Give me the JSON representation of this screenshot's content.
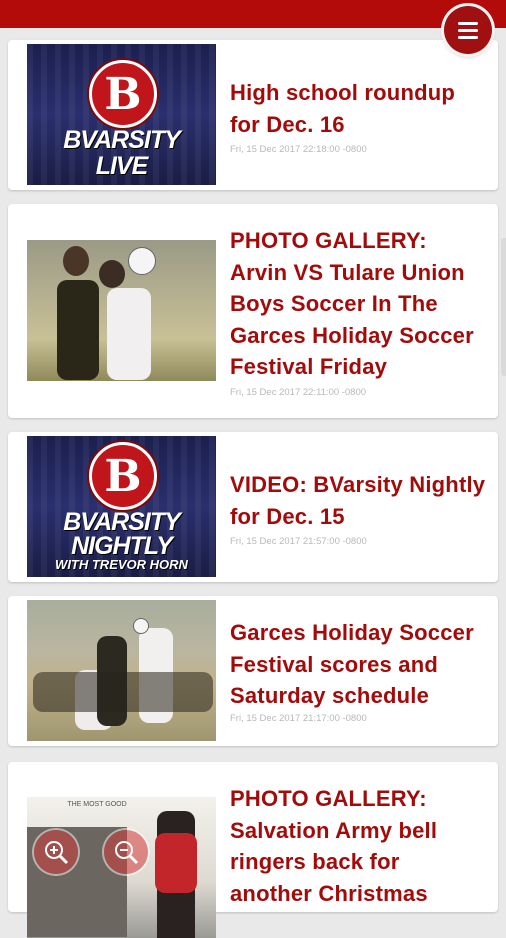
{
  "colors": {
    "brand": "#b30a0a",
    "title": "#a30b0b",
    "date": "#b8b8b8",
    "background": "#e9e9e9"
  },
  "menu": {
    "icon": "hamburger-menu-icon"
  },
  "articles": [
    {
      "title": "High school roundup for Dec. 16",
      "date": "Fri, 15 Dec 2017 22:18:00 -0800",
      "thumb": {
        "logo_letter": "B",
        "logo_line1": "BVARSITY",
        "logo_line2": "LIVE"
      }
    },
    {
      "title": "PHOTO GALLERY: Arvin VS Tulare Union Boys Soccer In The Garces Holiday Soccer Festival Friday",
      "date": "Fri, 15 Dec 2017 22:11:00 -0800"
    },
    {
      "title": "VIDEO: BVarsity Nightly for Dec. 15",
      "date": "Fri, 15 Dec 2017 21:57:00 -0800",
      "thumb": {
        "logo_letter": "B",
        "logo_line1": "BVARSITY",
        "logo_line2": "NIGHTLY",
        "logo_line3": "WITH TREVOR HORN"
      }
    },
    {
      "title": "Garces Holiday Soccer Festival scores and Saturday schedule",
      "date": "Fri, 15 Dec 2017 21:17:00 -0800"
    },
    {
      "title": "PHOTO GALLERY: Salvation Army bell ringers back for another Christmas",
      "date": "",
      "thumb": {
        "sign_text": "THE MOST GOOD"
      }
    }
  ],
  "zoom_controls": {
    "zoom_in_icon": "zoom-in-icon",
    "zoom_out_icon": "zoom-out-icon"
  }
}
